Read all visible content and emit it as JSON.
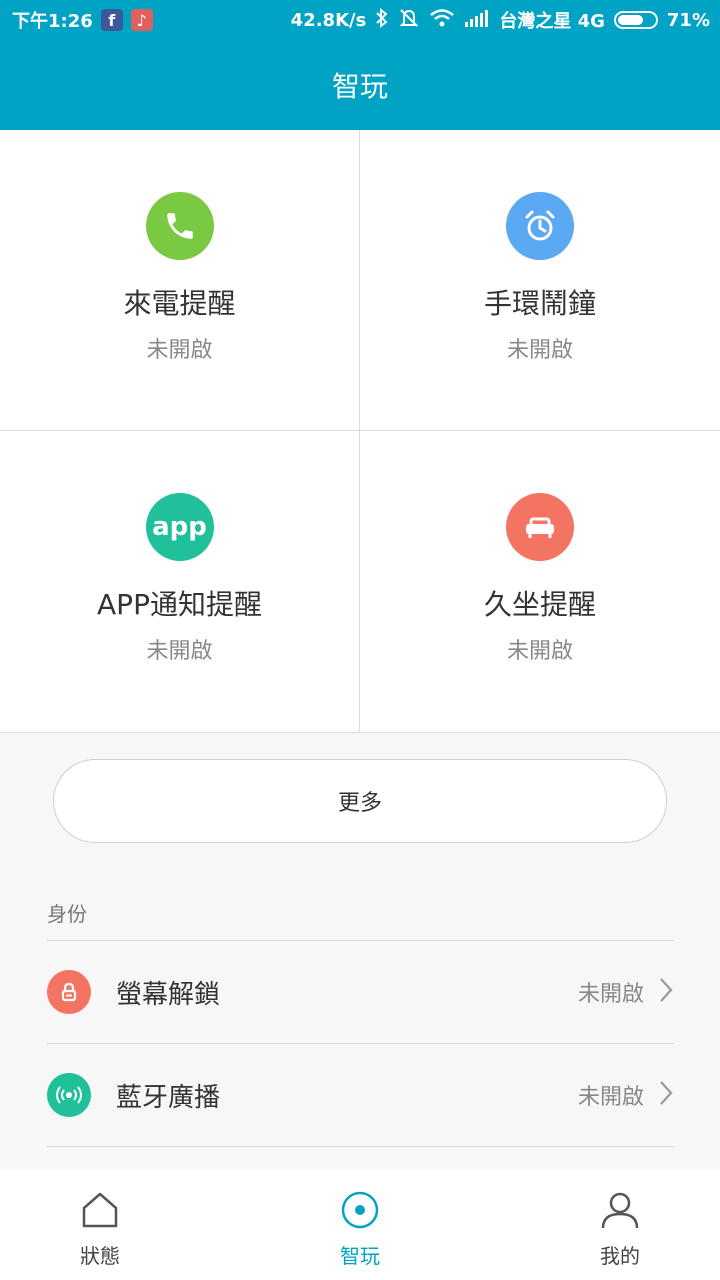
{
  "status_bar": {
    "time": "下午1:26",
    "speed": "42.8K/s",
    "carrier": "台灣之星 4G",
    "battery_percent": "71%",
    "battery_level": 0.71
  },
  "header": {
    "title": "智玩"
  },
  "features": [
    {
      "title": "來電提醒",
      "status": "未開啟",
      "icon": "phone-icon",
      "color": "#7ac943"
    },
    {
      "title": "手環鬧鐘",
      "status": "未開啟",
      "icon": "alarm-clock-icon",
      "color": "#5aa9f2"
    },
    {
      "title": "APP通知提醒",
      "status": "未開啟",
      "icon": "app-icon",
      "icon_text": "app",
      "color": "#1fc09a"
    },
    {
      "title": "久坐提醒",
      "status": "未開啟",
      "icon": "sofa-icon",
      "color": "#f47463"
    }
  ],
  "more_button": "更多",
  "identity": {
    "section_title": "身份",
    "items": [
      {
        "label": "螢幕解鎖",
        "value": "未開啟",
        "icon": "lock-icon",
        "color": "#f47463"
      },
      {
        "label": "藍牙廣播",
        "value": "未開啟",
        "icon": "broadcast-icon",
        "color": "#1fc09a"
      }
    ]
  },
  "tabs": [
    {
      "label": "狀態",
      "icon": "home-icon",
      "active": false
    },
    {
      "label": "智玩",
      "icon": "target-icon",
      "active": true
    },
    {
      "label": "我的",
      "icon": "person-icon",
      "active": false
    }
  ],
  "colors": {
    "accent": "#00a3c4"
  }
}
